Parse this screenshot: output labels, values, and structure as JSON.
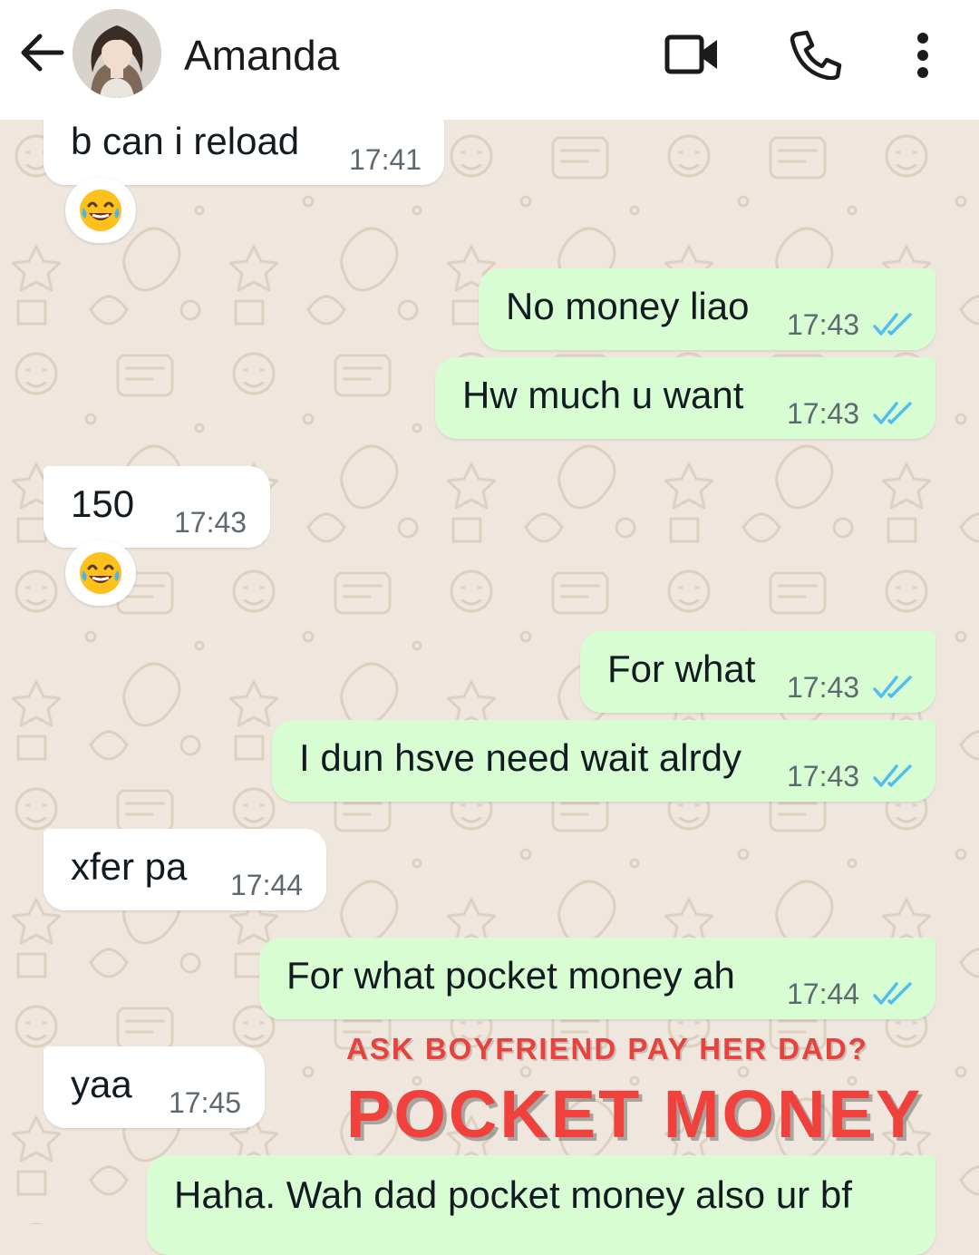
{
  "header": {
    "contact_name": "Amanda",
    "icons": {
      "back": "arrow-left-icon",
      "video": "video-camera-icon",
      "call": "phone-icon",
      "menu": "more-vertical-icon"
    }
  },
  "messages": [
    {
      "direction": "in",
      "text": "b can i reload",
      "time": "17:41",
      "reaction": "joy-emoji"
    },
    {
      "direction": "out",
      "text": "No money liao",
      "time": "17:43",
      "status": "read"
    },
    {
      "direction": "out",
      "text": "Hw much u want",
      "time": "17:43",
      "status": "read"
    },
    {
      "direction": "in",
      "text": "150",
      "time": "17:43",
      "reaction": "joy-emoji"
    },
    {
      "direction": "out",
      "text": "For what",
      "time": "17:43",
      "status": "read"
    },
    {
      "direction": "out",
      "text": "I dun hsve need wait alrdy",
      "time": "17:43",
      "status": "read"
    },
    {
      "direction": "in",
      "text": "xfer pa",
      "time": "17:44"
    },
    {
      "direction": "out",
      "text": "For what pocket money ah",
      "time": "17:44",
      "status": "read"
    },
    {
      "direction": "in",
      "text": "yaa",
      "time": "17:45"
    },
    {
      "direction": "out",
      "text": "Haha. Wah dad pocket money also ur bf"
    }
  ],
  "overlay": {
    "subtitle": "ASK BOYFRIEND PAY HER DAD?",
    "title": "POCKET MONEY"
  },
  "colors": {
    "chat_background": "#efe7dd",
    "incoming_bubble": "#ffffff",
    "outgoing_bubble": "#d9fdd3",
    "read_ticks": "#53bdeb",
    "overlay_text": "#f0413c"
  }
}
